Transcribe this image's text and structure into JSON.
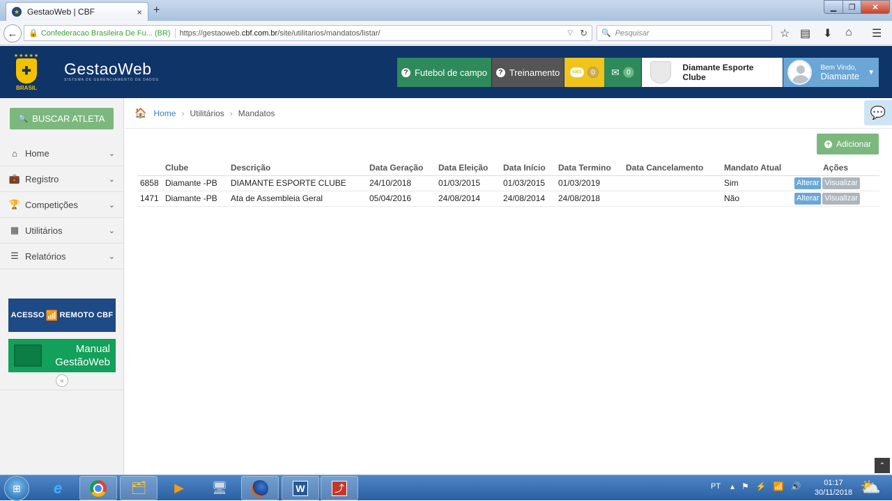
{
  "browser": {
    "tab_title": "GestaoWeb | CBF",
    "tab_close": "×",
    "new_tab": "+",
    "identity": "Confederacao Brasileira De Fu... (BR)",
    "url_prefix": "https://gestaoweb.",
    "url_domain": "cbf.com.br",
    "url_path": "/site/utilitarios/mandatos/listar/",
    "search_placeholder": "Pesquisar"
  },
  "header": {
    "brand_name": "GestaoWeb",
    "brand_sub": "SISTEMA DE GERENCIAMENTO DE DADOS",
    "logo_text": "BRASIL",
    "futebol_label": "Futebol de campo",
    "treinamento_label": "Treinamento",
    "sms_text": "SMS",
    "sms_count": "0",
    "mail_count": "0",
    "club_name": "Diamante Esporte Clube",
    "welcome": "Bem Vindo,",
    "user_name": "Diamante"
  },
  "sidebar": {
    "search_button": "BUSCAR ATLETA",
    "items": [
      {
        "label": "Home"
      },
      {
        "label": "Registro"
      },
      {
        "label": "Competições"
      },
      {
        "label": "Utilitários"
      },
      {
        "label": "Relatórios"
      }
    ],
    "remote_access_a": "ACESSO",
    "remote_access_b": "REMOTO",
    "remote_access_c": "CBF",
    "manual_line1": "Manual",
    "manual_line2": "GestãoWeb"
  },
  "breadcrumb": {
    "home": "Home",
    "level1": "Utilitários",
    "level2": "Mandatos"
  },
  "main": {
    "add_button": "Adicionar",
    "table": {
      "headers": [
        "",
        "Clube",
        "Descrição",
        "Data Geração",
        "Data Eleição",
        "Data Início",
        "Data Termino",
        "Data Cancelamento",
        "Mandato Atual",
        "Ações"
      ],
      "rows": [
        {
          "id": "6858",
          "clube": "Diamante -PB",
          "descricao": "DIAMANTE ESPORTE CLUBE",
          "geracao": "24/10/2018",
          "eleicao": "01/03/2015",
          "inicio": "01/03/2015",
          "termino": "01/03/2019",
          "cancelamento": "",
          "atual": "Sim"
        },
        {
          "id": "1471",
          "clube": "Diamante -PB",
          "descricao": "Ata de Assembleia Geral",
          "geracao": "05/04/2016",
          "eleicao": "24/08/2014",
          "inicio": "24/08/2014",
          "termino": "24/08/2018",
          "cancelamento": "",
          "atual": "Não"
        }
      ],
      "alterar_label": "Alterar",
      "visualizar_label": "Visualizar"
    }
  },
  "taskbar": {
    "lang": "PT",
    "time": "01:17",
    "date": "30/11/2018"
  },
  "colors": {
    "header_bg": "#0f3468",
    "accent_green": "#7cb87e",
    "link_blue": "#3a7fbf"
  }
}
